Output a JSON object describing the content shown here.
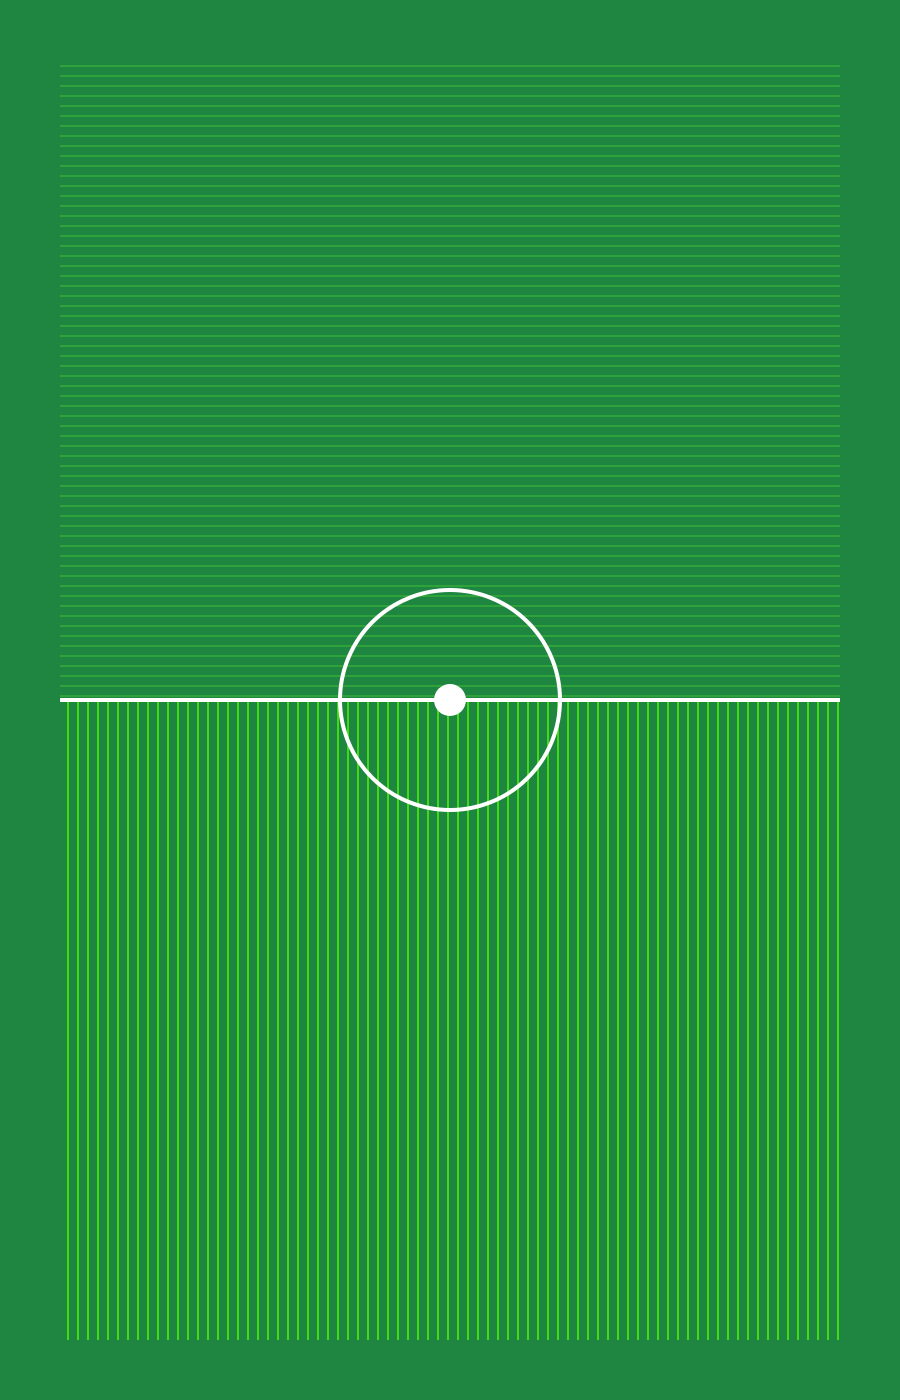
{
  "colors": {
    "background": "#1f8641",
    "upper_stripe": "#2ea33a",
    "lower_stripe": "#3fdc14",
    "markings": "#ffffff"
  },
  "pitch": {
    "upper_pattern": "horizontal-stripes",
    "lower_pattern": "vertical-stripes",
    "elements": [
      "halfway-line",
      "center-circle",
      "center-spot"
    ]
  }
}
